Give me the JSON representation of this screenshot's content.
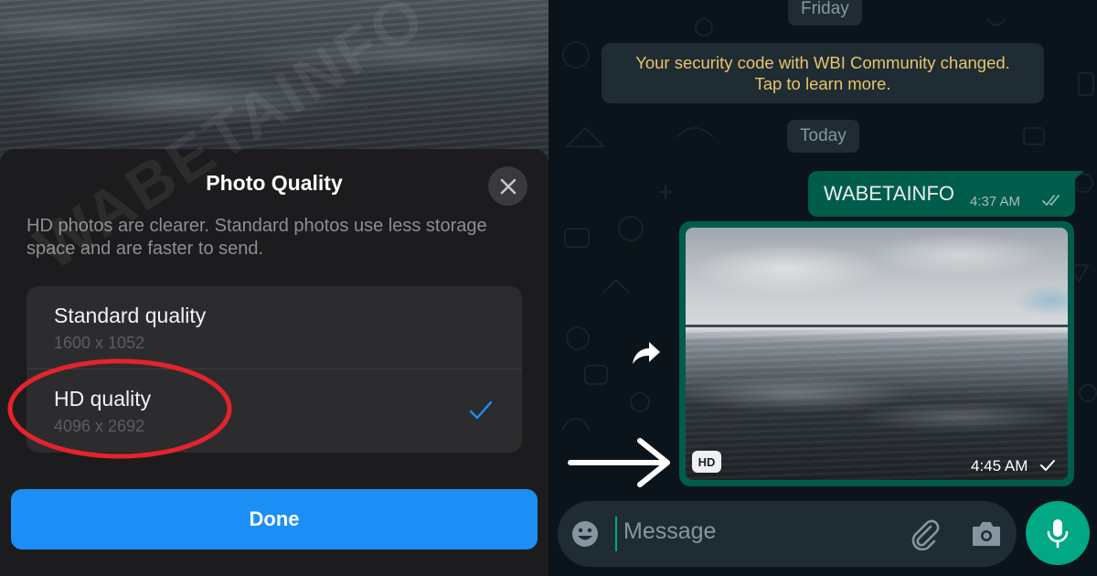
{
  "photo_quality_sheet": {
    "title": "Photo Quality",
    "description": "HD photos are clearer. Standard photos use less storage space and are faster to send.",
    "options": [
      {
        "label": "Standard quality",
        "dimensions": "1600 x 1052",
        "selected": false
      },
      {
        "label": "HD quality",
        "dimensions": "4096 x 2692",
        "selected": true
      }
    ],
    "watermark": "WABETAINFO",
    "done_label": "Done",
    "icons": {
      "close": "close-icon",
      "check": "checkmark-icon"
    },
    "colors": {
      "accent": "#1b8ff5",
      "highlight_oval": "#e5232d",
      "sheet_bg": "#1c1c1e"
    }
  },
  "chat": {
    "day_labels": {
      "previous": "Friday",
      "current": "Today"
    },
    "security_notice": {
      "line1": "Your security code with WBI Community changed.",
      "line2": "Tap to learn more."
    },
    "messages": [
      {
        "type": "text",
        "text": "WABETAINFO",
        "time": "4:37 AM",
        "status": "read"
      },
      {
        "type": "image",
        "badge": "HD",
        "time": "4:45 AM",
        "status": "sent"
      }
    ],
    "composer": {
      "placeholder": "Message"
    },
    "icons": {
      "forward": "forward-icon",
      "emoji": "emoji-icon",
      "attach": "paperclip-icon",
      "camera": "camera-icon",
      "mic": "microphone-icon",
      "annotation_arrow": "arrow-right-icon"
    },
    "colors": {
      "outgoing_bubble": "#005c4b",
      "accent": "#00a884",
      "notice_text": "#e9c46a",
      "background": "#0b141a"
    }
  }
}
